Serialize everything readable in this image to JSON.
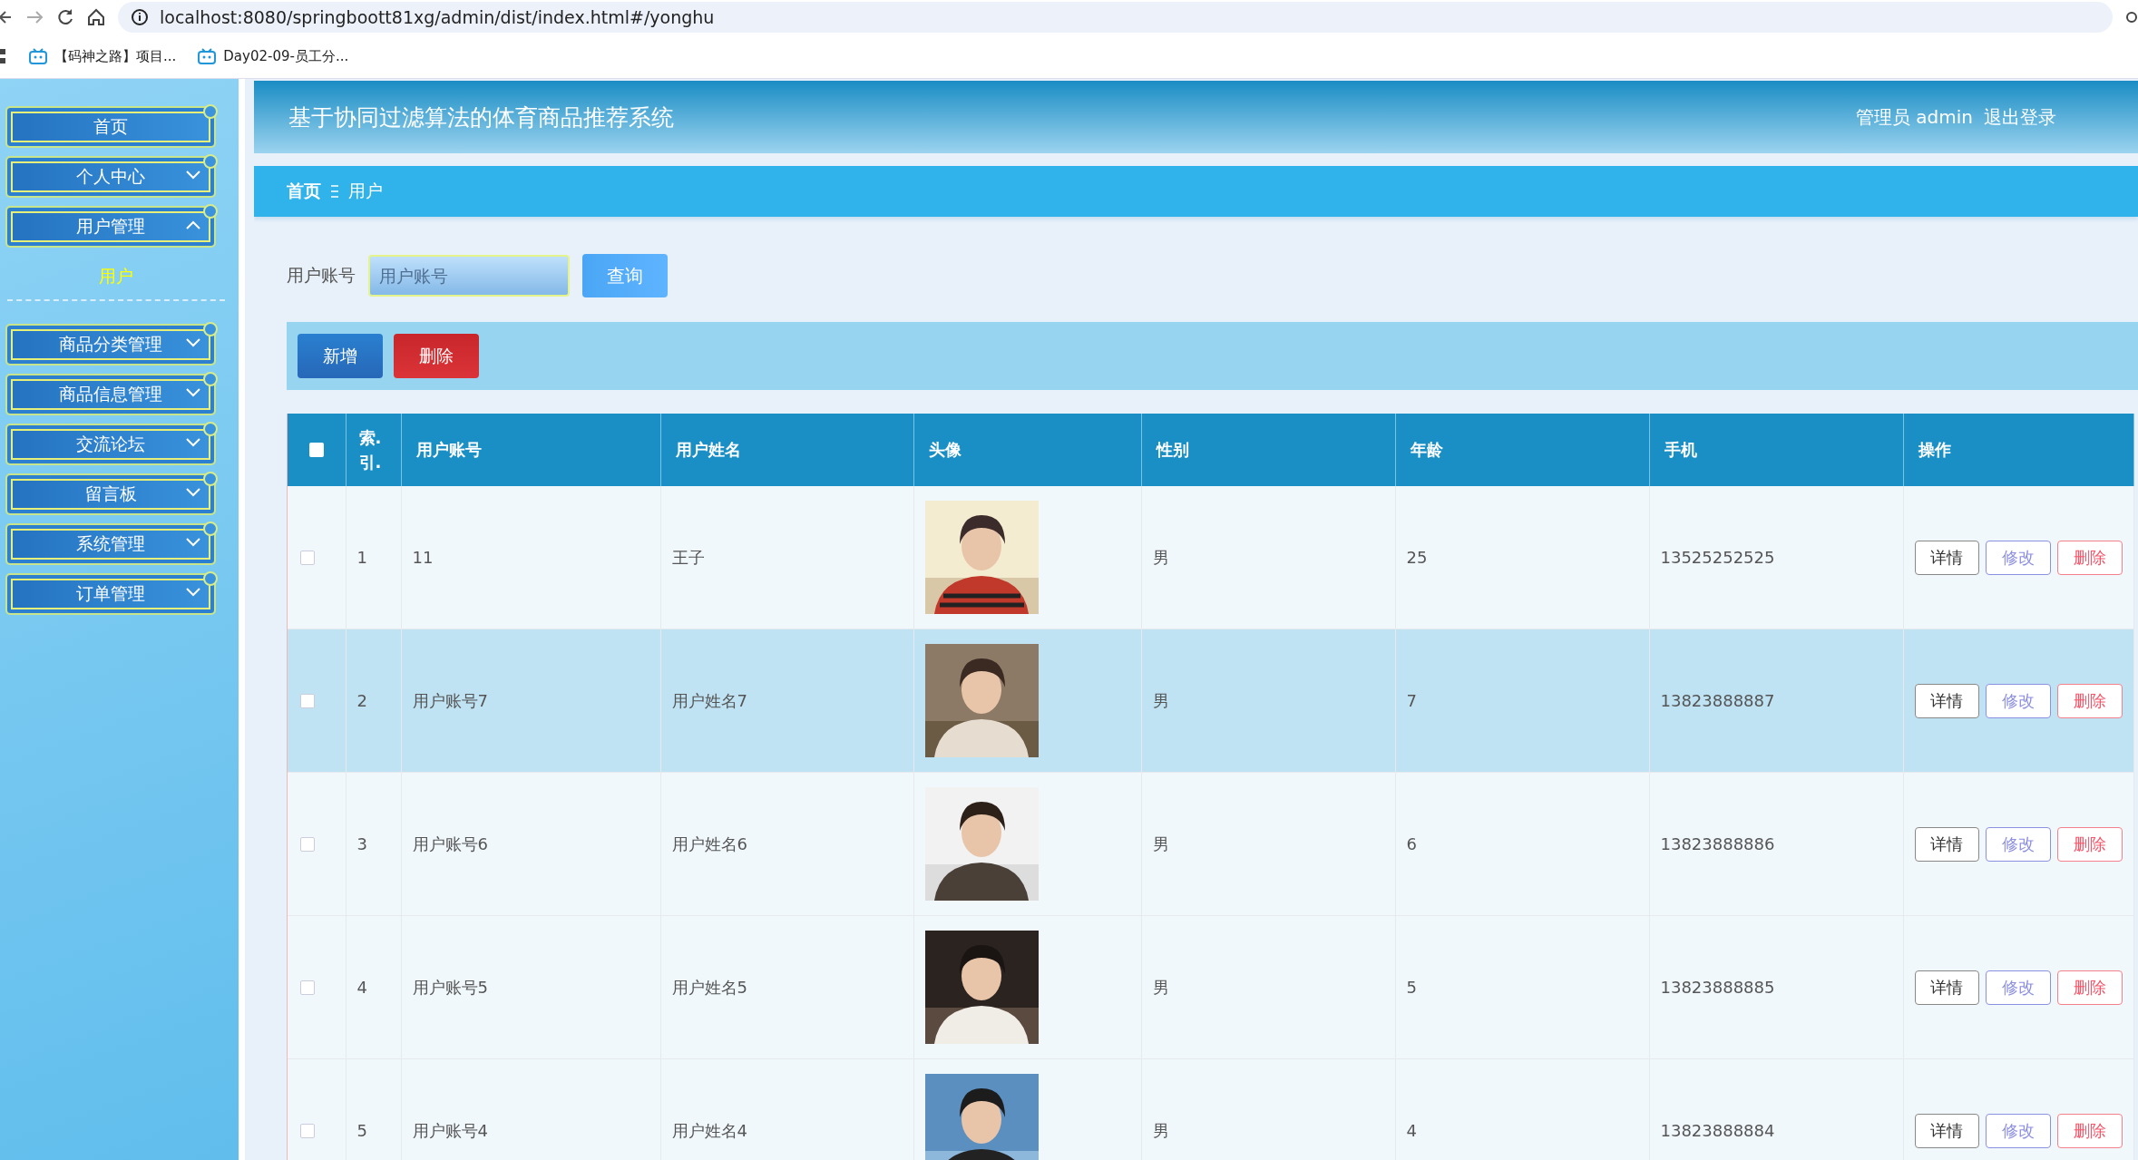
{
  "browser": {
    "url": "localhost:8080/springboott81xg/admin/dist/index.html#/yonghu",
    "bookmarks": [
      "【码神之路】项目...",
      "Day02-09-员工分..."
    ]
  },
  "sidebar": {
    "items": [
      {
        "label": "首页",
        "kind": "link"
      },
      {
        "label": "个人中心",
        "kind": "menu",
        "expanded": false
      },
      {
        "label": "用户管理",
        "kind": "menu",
        "expanded": true,
        "children": [
          {
            "label": "用户",
            "selected": true
          }
        ]
      },
      {
        "label": "商品分类管理",
        "kind": "menu",
        "expanded": false
      },
      {
        "label": "商品信息管理",
        "kind": "menu",
        "expanded": false
      },
      {
        "label": "交流论坛",
        "kind": "menu",
        "expanded": false
      },
      {
        "label": "留言板",
        "kind": "menu",
        "expanded": false
      },
      {
        "label": "系统管理",
        "kind": "menu",
        "expanded": false
      },
      {
        "label": "订单管理",
        "kind": "menu",
        "expanded": false
      }
    ]
  },
  "header": {
    "title": "基于协同过滤算法的体育商品推荐系统",
    "user": "管理员 admin",
    "logout": "退出登录"
  },
  "breadcrumb": [
    "首页",
    "用户"
  ],
  "search": {
    "label": "用户账号",
    "placeholder": "用户账号",
    "button": "查询"
  },
  "actions": [
    {
      "label": "新增",
      "kind": "add"
    },
    {
      "label": "删除",
      "kind": "delete"
    }
  ],
  "table": {
    "select_all": {
      "checked": false
    },
    "columns": [
      "索.引.",
      "用户账号",
      "用户姓名",
      "头像",
      "性别",
      "年龄",
      "手机",
      "操作"
    ],
    "rows": [
      {
        "index": "1",
        "account": "11",
        "name": "王子",
        "gender": "男",
        "age": "25",
        "phone": "13525252525",
        "checked": false,
        "selected": false,
        "actions": [
          {
            "label": "详情",
            "kind": "detail"
          },
          {
            "label": "修改",
            "kind": "edit"
          },
          {
            "label": "删除",
            "kind": "delete"
          }
        ]
      },
      {
        "index": "2",
        "account": "用户账号7",
        "name": "用户姓名7",
        "gender": "男",
        "age": "7",
        "phone": "13823888887",
        "checked": false,
        "selected": true,
        "actions": [
          {
            "label": "详情",
            "kind": "detail"
          },
          {
            "label": "修改",
            "kind": "edit"
          },
          {
            "label": "删除",
            "kind": "delete"
          }
        ]
      },
      {
        "index": "3",
        "account": "用户账号6",
        "name": "用户姓名6",
        "gender": "男",
        "age": "6",
        "phone": "13823888886",
        "checked": false,
        "selected": false,
        "actions": [
          {
            "label": "详情",
            "kind": "detail"
          },
          {
            "label": "修改",
            "kind": "edit"
          },
          {
            "label": "删除",
            "kind": "delete"
          }
        ]
      },
      {
        "index": "4",
        "account": "用户账号5",
        "name": "用户姓名5",
        "gender": "男",
        "age": "5",
        "phone": "13823888885",
        "checked": false,
        "selected": false,
        "actions": [
          {
            "label": "详情",
            "kind": "detail"
          },
          {
            "label": "修改",
            "kind": "edit"
          },
          {
            "label": "删除",
            "kind": "delete"
          }
        ]
      },
      {
        "index": "5",
        "account": "用户账号4",
        "name": "用户姓名4",
        "gender": "男",
        "age": "4",
        "phone": "13823888884",
        "checked": false,
        "selected": false,
        "actions": [
          {
            "label": "详情",
            "kind": "detail"
          },
          {
            "label": "修改",
            "kind": "edit"
          },
          {
            "label": "删除",
            "kind": "delete"
          }
        ]
      }
    ]
  }
}
